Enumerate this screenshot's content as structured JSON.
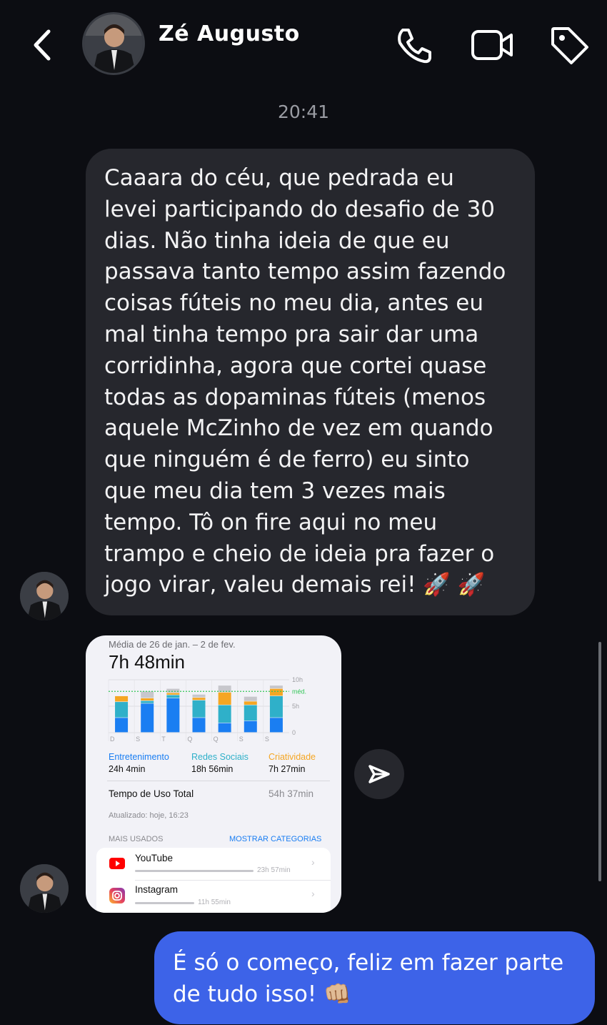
{
  "header": {
    "contact_name": "Zé Augusto"
  },
  "timestamp": "20:41",
  "incoming_message": {
    "lines": [
      "Caaara do céu, que pedrada eu",
      "levei participando do desafio de 30",
      "dias. Não tinha ideia de que eu",
      "passava tanto tempo assim fazendo",
      "coisas fúteis no meu dia, antes eu",
      "mal tinha tempo pra sair dar uma",
      "corridinha, agora que cortei quase",
      "todas as dopaminas fúteis (menos",
      "aquele McZinho de vez em quando",
      "que ninguém é de ferro) eu sinto",
      "que meu dia tem 3 vezes mais",
      "tempo. Tô on fire aqui no meu",
      "trampo e cheio de ideia pra fazer o",
      "jogo virar, valeu demais rei! 🚀 🚀"
    ]
  },
  "screen_time_card": {
    "period": "Média de 26 de jan. – 2 de fev.",
    "average": "7h 48min",
    "axis_labels": [
      "10h",
      "méd.",
      "5h",
      "0"
    ],
    "day_labels": [
      "D",
      "S",
      "T",
      "Q",
      "Q",
      "S",
      "S"
    ],
    "categories": [
      {
        "name": "Entretenimento",
        "value": "24h 4min",
        "color": "#1a7ef2"
      },
      {
        "name": "Redes Sociais",
        "value": "18h 56min",
        "color": "#2fb0c9"
      },
      {
        "name": "Criatividade",
        "value": "7h 27min",
        "color": "#f5a623"
      }
    ],
    "total_label": "Tempo de Uso Total",
    "total_value": "54h 37min",
    "updated": "Atualizado: hoje, 16:23",
    "most_used_label": "MAIS USADOS",
    "show_categories": "MOSTRAR CATEGORIAS",
    "apps": [
      {
        "name": "YouTube",
        "time": "23h 57min",
        "fraction": 1.0
      },
      {
        "name": "Instagram",
        "time": "11h 55min",
        "fraction": 0.5
      }
    ]
  },
  "chart_data": {
    "type": "bar",
    "categories": [
      "D",
      "S",
      "T",
      "Q",
      "Q",
      "S",
      "S"
    ],
    "series": [
      {
        "name": "Entretenimento",
        "values": [
          2.8,
          5.5,
          6.5,
          2.8,
          1.8,
          2.2,
          2.8
        ]
      },
      {
        "name": "Redes Sociais",
        "values": [
          3.0,
          0.5,
          0.6,
          3.3,
          3.4,
          3.0,
          4.1
        ]
      },
      {
        "name": "Criatividade",
        "values": [
          1.1,
          0.5,
          0.4,
          0.5,
          2.4,
          0.7,
          1.4
        ]
      },
      {
        "name": "Outros",
        "values": [
          0.0,
          1.3,
          0.8,
          0.6,
          1.3,
          0.9,
          0.6
        ]
      }
    ],
    "ylim": [
      0,
      10
    ],
    "yticks": [
      "0",
      "5h",
      "10h"
    ],
    "average_line": 7.8,
    "average_label": "méd."
  },
  "outgoing_message": {
    "lines": [
      "É só o começo, feliz em fazer parte",
      "de tudo isso! 👊🏼"
    ]
  },
  "colors": {
    "background": "#0c0d12",
    "incoming_bubble": "#26272d",
    "outgoing_bubble": "#3d63e8",
    "average_line": "#34c759",
    "other_bar": "#c7c7cc"
  }
}
